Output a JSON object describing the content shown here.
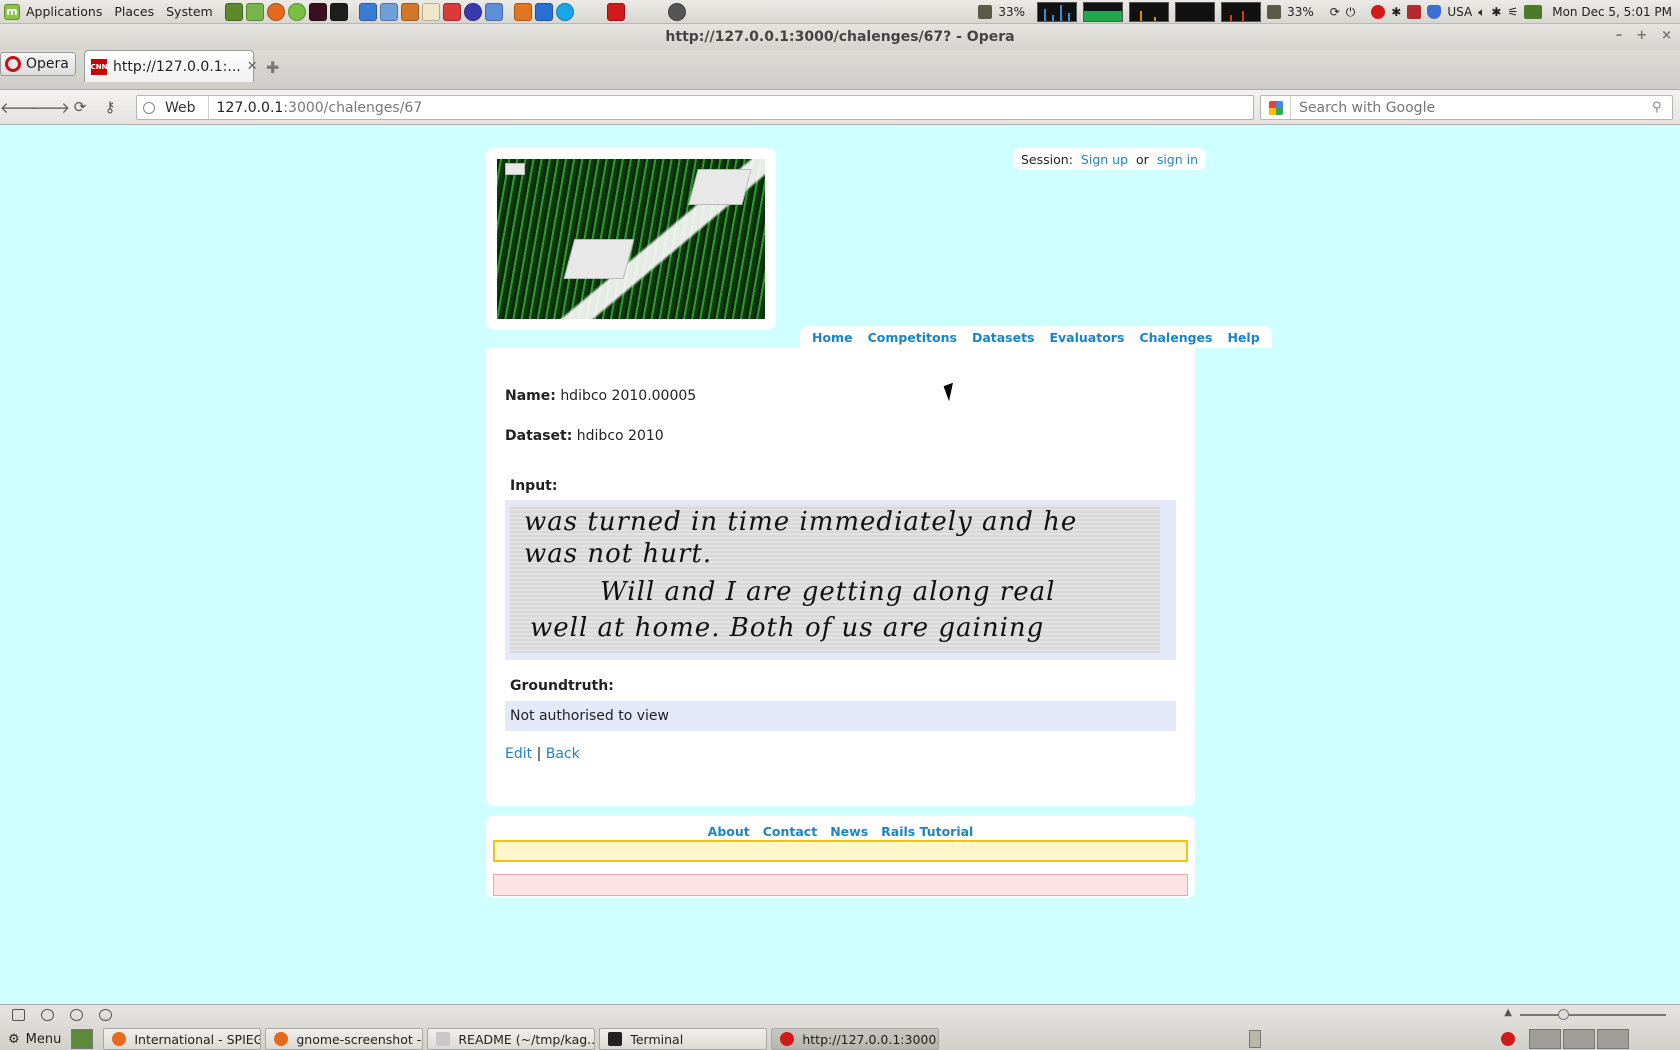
{
  "top_panel": {
    "menus": [
      "Applications",
      "Places",
      "System"
    ],
    "battery_1": "33%",
    "battery_2": "33%",
    "keyboard_layout": "USA",
    "clock": "Mon Dec  5,  5:01 PM"
  },
  "window": {
    "title": "http://127.0.0.1:3000/chalenges/67? - Opera",
    "opera_button": "Opera",
    "tab_title": "http://127.0.0.1:...",
    "address_label": "Web",
    "address_host": "127.0.0.1",
    "address_path": ":3000/chalenges/67",
    "search_placeholder": "Search with Google"
  },
  "page": {
    "session": {
      "label": "Session:",
      "signup": "Sign up",
      "or": "or",
      "signin": "sign in"
    },
    "nav": [
      "Home",
      "Competitons",
      "Datasets",
      "Evaluators",
      "Chalenges",
      "Help"
    ],
    "name_label": "Name:",
    "name_value": "hdibco 2010.00005",
    "dataset_label": "Dataset:",
    "dataset_value": "hdibco 2010",
    "input_label": "Input:",
    "handwriting_lines": [
      "was turned in time immediately and he",
      "was not hurt.",
      "Will and I are getting along real",
      "well at home. Both of us are gaining"
    ],
    "groundtruth_label": "Groundtruth:",
    "groundtruth_value": "Not authorised to view",
    "edit_link": "Edit",
    "separator": "|",
    "back_link": "Back",
    "footer_links": [
      "About",
      "Contact",
      "News",
      "Rails Tutorial"
    ]
  },
  "taskbar": {
    "menu_label": "Menu",
    "tasks": [
      "International - SPIEGE...",
      "gnome-screenshot - ...",
      "README (~/tmp/kag...",
      "Terminal",
      "http://127.0.0.1:3000..."
    ]
  }
}
